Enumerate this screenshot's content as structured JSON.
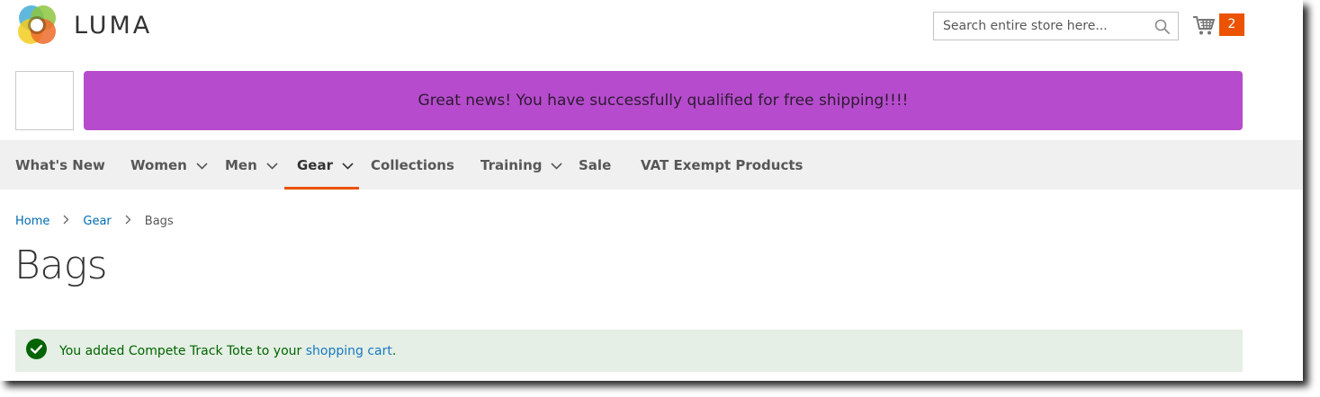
{
  "header": {
    "logo_text": "LUMA",
    "search": {
      "placeholder": "Search entire store here..."
    },
    "cart": {
      "count": "2"
    }
  },
  "promo": {
    "message": "Great news! You have successfully qualified for free shipping!!!!"
  },
  "nav": {
    "items": [
      {
        "label": "What's New"
      },
      {
        "label": "Women"
      },
      {
        "label": "Men"
      },
      {
        "label": "Gear"
      },
      {
        "label": "Collections"
      },
      {
        "label": "Training"
      },
      {
        "label": "Sale"
      },
      {
        "label": "VAT Exempt Products"
      }
    ],
    "active": "Gear"
  },
  "breadcrumb": {
    "home": "Home",
    "gear": "Gear",
    "current": "Bags"
  },
  "page": {
    "title": "Bags"
  },
  "message": {
    "prefix": "You added Compete Track Tote to your ",
    "link": "shopping cart",
    "suffix": "."
  },
  "colors": {
    "accent": "#eb5202",
    "promo_bg": "#b64ccd",
    "nav_bg": "#f0f0f0",
    "success_bg": "#e5efe5",
    "success_text": "#006400",
    "link": "#006bb4"
  }
}
